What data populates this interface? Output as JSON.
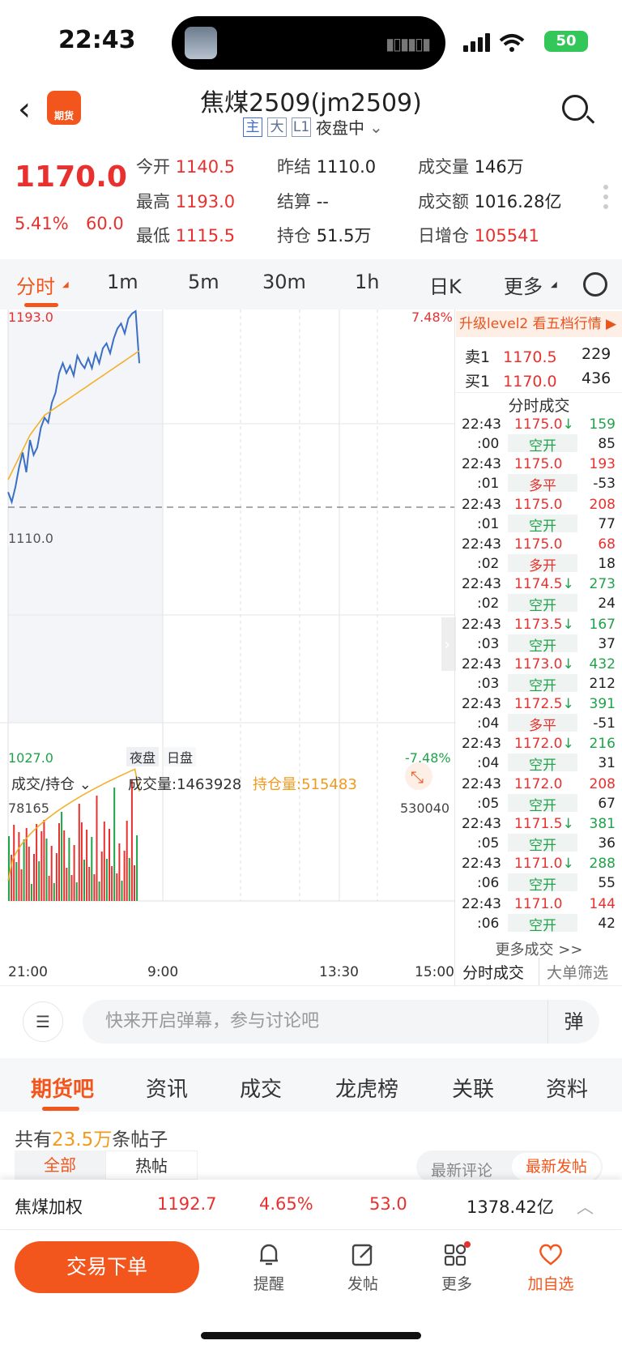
{
  "status": {
    "time": "22:43",
    "battery": "50"
  },
  "header": {
    "logo_text": "期货",
    "title": "焦煤2509(jm2509)",
    "tags": [
      "主",
      "大",
      "L1"
    ],
    "session": "夜盘中"
  },
  "quote": {
    "price": "1170.0",
    "change_pct": "5.41%",
    "change": "60.0",
    "fields": [
      {
        "k": "今开",
        "v": "1140.5",
        "color": "red"
      },
      {
        "k": "昨结",
        "v": "1110.0",
        "color": "dark"
      },
      {
        "k": "成交量",
        "v": "146万",
        "color": "dark"
      },
      {
        "k": "最高",
        "v": "1193.0",
        "color": "red"
      },
      {
        "k": "结算",
        "v": "--",
        "color": "dark"
      },
      {
        "k": "成交额",
        "v": "1016.28亿",
        "color": "dark"
      },
      {
        "k": "最低",
        "v": "1115.5",
        "color": "red"
      },
      {
        "k": "持仓",
        "v": "51.5万",
        "color": "dark"
      },
      {
        "k": "日增仓",
        "v": "105541",
        "color": "red"
      }
    ]
  },
  "period_tabs": [
    "分时",
    "1m",
    "5m",
    "30m",
    "1h",
    "日K",
    "更多"
  ],
  "chart_data": {
    "type": "line",
    "y_top_price": "1193.0",
    "y_top_pct": "7.48%",
    "y_mid_price": "1110.0",
    "y_bottom_price": "1027.0",
    "y_bottom_pct": "-7.48%",
    "session_labels": [
      "夜盘",
      "日盘"
    ],
    "x_ticks": [
      "21:00",
      "9:00",
      "13:30",
      "15:00"
    ],
    "price_series": [
      1120,
      1116,
      1122,
      1130,
      1136,
      1128,
      1141,
      1135,
      1138,
      1146,
      1150,
      1148,
      1156,
      1160,
      1168,
      1172,
      1168,
      1171,
      1167,
      1175,
      1172,
      1170,
      1174,
      1170,
      1176,
      1172,
      1178,
      1180,
      1176,
      1182,
      1186,
      1188,
      1184,
      1190,
      1192,
      1193,
      1172
    ],
    "avg_series": [
      1125,
      1128,
      1131,
      1134,
      1137,
      1140,
      1143,
      1145,
      1147,
      1149,
      1151,
      1152,
      1153,
      1154,
      1155,
      1156,
      1157,
      1158,
      1159,
      1160,
      1161,
      1162,
      1163,
      1164,
      1165,
      1166,
      1167,
      1168,
      1169,
      1170,
      1171,
      1172,
      1173,
      1174,
      1175,
      1176,
      1177
    ],
    "volume_label": "成交/持仓",
    "volume_total": "成交量:1463928",
    "open_interest": "持仓量:515483",
    "vol_left_label": "78165",
    "vol_right_label": "530040"
  },
  "level2_banner": "升级level2 看五档行情 ▶",
  "orderbook": [
    {
      "side": "卖1",
      "price": "1170.5",
      "qty": "229"
    },
    {
      "side": "买1",
      "price": "1170.0",
      "qty": "436"
    }
  ],
  "trades_title": "分时成交",
  "trades": [
    {
      "t1": "22:43",
      "t2": ":00",
      "price": "1175.0",
      "dir": "↓",
      "qty": "159",
      "type": "空开",
      "vol": "85"
    },
    {
      "t1": "22:43",
      "t2": ":01",
      "price": "1175.0",
      "dir": "",
      "qty": "193",
      "type": "多平",
      "vol": "-53"
    },
    {
      "t1": "22:43",
      "t2": ":01",
      "price": "1175.0",
      "dir": "",
      "qty": "208",
      "type": "空开",
      "vol": "77"
    },
    {
      "t1": "22:43",
      "t2": ":02",
      "price": "1175.0",
      "dir": "",
      "qty": "68",
      "type": "多开",
      "vol": "18"
    },
    {
      "t1": "22:43",
      "t2": ":02",
      "price": "1174.5",
      "dir": "↓",
      "qty": "273",
      "type": "空开",
      "vol": "24"
    },
    {
      "t1": "22:43",
      "t2": ":03",
      "price": "1173.5",
      "dir": "↓",
      "qty": "167",
      "type": "空开",
      "vol": "37"
    },
    {
      "t1": "22:43",
      "t2": ":03",
      "price": "1173.0",
      "dir": "↓",
      "qty": "432",
      "type": "空开",
      "vol": "212"
    },
    {
      "t1": "22:43",
      "t2": ":04",
      "price": "1172.5",
      "dir": "↓",
      "qty": "391",
      "type": "多平",
      "vol": "-51"
    },
    {
      "t1": "22:43",
      "t2": ":04",
      "price": "1172.0",
      "dir": "↓",
      "qty": "216",
      "type": "空开",
      "vol": "31"
    },
    {
      "t1": "22:43",
      "t2": ":05",
      "price": "1172.0",
      "dir": "",
      "qty": "208",
      "type": "空开",
      "vol": "67"
    },
    {
      "t1": "22:43",
      "t2": ":05",
      "price": "1171.5",
      "dir": "↓",
      "qty": "381",
      "type": "空开",
      "vol": "36"
    },
    {
      "t1": "22:43",
      "t2": ":06",
      "price": "1171.0",
      "dir": "↓",
      "qty": "288",
      "type": "空开",
      "vol": "55"
    },
    {
      "t1": "22:43",
      "t2": ":06",
      "price": "1171.0",
      "dir": "",
      "qty": "144",
      "type": "空开",
      "vol": "42"
    }
  ],
  "more_trades": "更多成交 >>",
  "panel_tabs": [
    "分时成交",
    "大单筛选"
  ],
  "comment": {
    "placeholder": "快来开启弹幕，参与讨论吧",
    "btn": "弹"
  },
  "section_tabs": [
    "期货吧",
    "资讯",
    "成交",
    "龙虎榜",
    "关联",
    "资料"
  ],
  "posts": {
    "prefix": "共有",
    "count": "23.5万",
    "suffix": "条帖子",
    "filters": [
      "全部",
      "热帖"
    ],
    "sort": [
      "最新评论",
      "最新发帖"
    ]
  },
  "index_bar": {
    "name": "焦煤加权",
    "price": "1192.7",
    "pct": "4.65%",
    "chg": "53.0",
    "amount": "1378.42亿"
  },
  "bottom_nav": {
    "trade": "交易下单",
    "items": [
      "提醒",
      "发帖",
      "更多",
      "加自选"
    ]
  }
}
